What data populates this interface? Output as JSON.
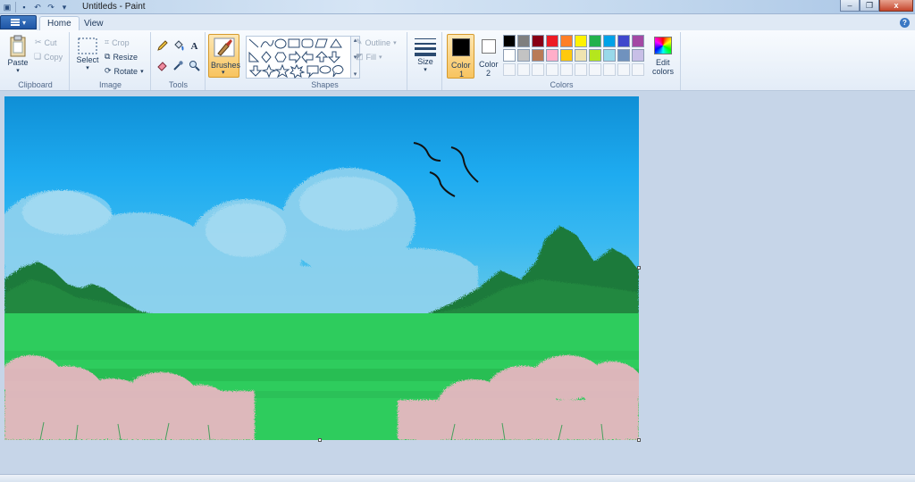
{
  "window": {
    "title": "Untitleds - Paint",
    "minimize_glyph": "–",
    "restore_glyph": "❐",
    "close_glyph": "x"
  },
  "tabs": [
    {
      "label": "Home",
      "active": true
    },
    {
      "label": "View",
      "active": false
    }
  ],
  "ribbon": {
    "clipboard": {
      "group_label": "Clipboard",
      "paste_label": "Paste",
      "cut_label": "Cut",
      "copy_label": "Copy"
    },
    "image": {
      "group_label": "Image",
      "select_label": "Select",
      "crop_label": "Crop",
      "resize_label": "Resize",
      "rotate_label": "Rotate"
    },
    "tools": {
      "group_label": "Tools",
      "text_tool_glyph": "A"
    },
    "brushes": {
      "label": "Brushes"
    },
    "shapes": {
      "group_label": "Shapes",
      "outline_label": "Outline",
      "fill_label": "Fill"
    },
    "size": {
      "label": "Size"
    },
    "colors": {
      "group_label": "Colors",
      "color1_label": "Color",
      "color1_number": "1",
      "color2_label": "Color",
      "color2_number": "2",
      "edit_colors_label_line1": "Edit",
      "edit_colors_label_line2": "colors",
      "color1_value": "#000000",
      "color2_value": "#ffffff",
      "palette_row1": [
        "#000000",
        "#7f7f7f",
        "#880015",
        "#ed1c24",
        "#ff7f27",
        "#fff200",
        "#22b14c",
        "#00a2e8",
        "#3f48cc",
        "#a349a4"
      ],
      "palette_row2": [
        "#ffffff",
        "#c3c3c3",
        "#b97a57",
        "#ffaec9",
        "#ffc90e",
        "#efe4b0",
        "#b5e61d",
        "#99d9ea",
        "#7092be",
        "#c8bfe7"
      ]
    }
  },
  "help_glyph": "?"
}
